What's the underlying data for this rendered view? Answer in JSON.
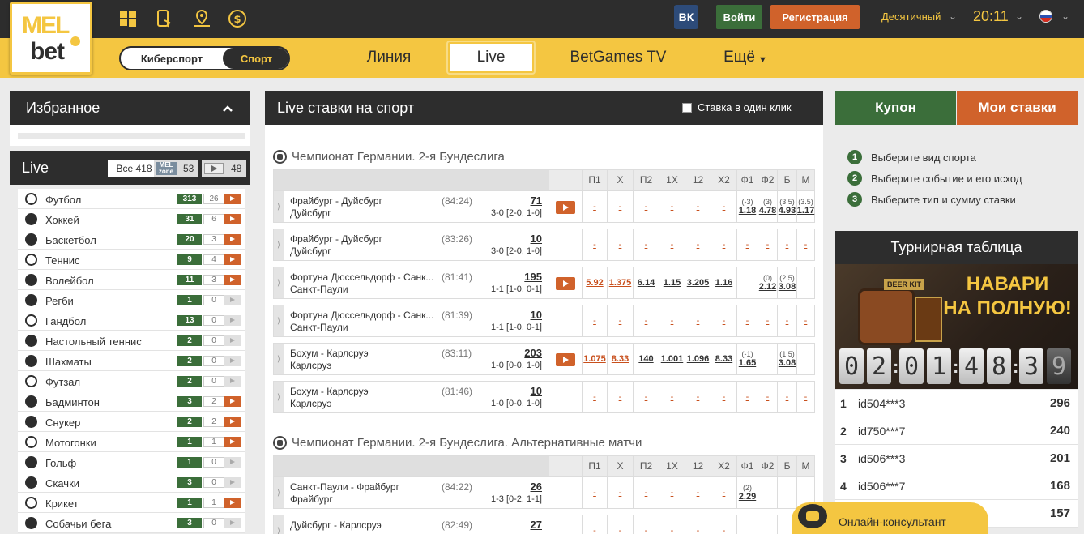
{
  "header": {
    "logo_top": "MEL",
    "logo_bottom": "bet",
    "vk_label": "ВК",
    "login_label": "Войти",
    "register_label": "Регистрация",
    "odds_format": "Десятичный",
    "time": "20:11",
    "toggle_esports": "Киберспорт",
    "toggle_sport": "Спорт",
    "nav": [
      "Линия",
      "Live",
      "BetGames TV",
      "Ещё"
    ],
    "colors": {
      "dark": "#2d2d2d",
      "yellow": "#f4c641",
      "green": "#3b6e3a",
      "orange": "#d0622b"
    }
  },
  "sidebar": {
    "favorites_title": "Избранное",
    "live_title": "Live",
    "count_all": "Все 418",
    "melzone_label": "MEL zone",
    "count_melzone": "53",
    "count_video": "48",
    "sports": [
      {
        "name": "Футбол",
        "c1": "313",
        "c2": "26",
        "video": true
      },
      {
        "name": "Хоккей",
        "c1": "31",
        "c2": "6",
        "video": true
      },
      {
        "name": "Баскетбол",
        "c1": "20",
        "c2": "3",
        "video": true
      },
      {
        "name": "Теннис",
        "c1": "9",
        "c2": "4",
        "video": true
      },
      {
        "name": "Волейбол",
        "c1": "11",
        "c2": "3",
        "video": true
      },
      {
        "name": "Регби",
        "c1": "1",
        "c2": "0",
        "video": false
      },
      {
        "name": "Гандбол",
        "c1": "13",
        "c2": "0",
        "video": false
      },
      {
        "name": "Настольный теннис",
        "c1": "2",
        "c2": "0",
        "video": false
      },
      {
        "name": "Шахматы",
        "c1": "2",
        "c2": "0",
        "video": false
      },
      {
        "name": "Футзал",
        "c1": "2",
        "c2": "0",
        "video": false
      },
      {
        "name": "Бадминтон",
        "c1": "3",
        "c2": "2",
        "video": true
      },
      {
        "name": "Снукер",
        "c1": "2",
        "c2": "2",
        "video": true
      },
      {
        "name": "Мотогонки",
        "c1": "1",
        "c2": "1",
        "video": true
      },
      {
        "name": "Гольф",
        "c1": "1",
        "c2": "0",
        "video": false
      },
      {
        "name": "Скачки",
        "c1": "3",
        "c2": "0",
        "video": false
      },
      {
        "name": "Крикет",
        "c1": "1",
        "c2": "1",
        "video": true
      },
      {
        "name": "Собачьи бега",
        "c1": "3",
        "c2": "0",
        "video": false
      }
    ]
  },
  "main": {
    "title": "Live ставки на спорт",
    "one_click": "Ставка в один клик",
    "columns": [
      "П1",
      "Х",
      "П2",
      "1Х",
      "12",
      "Х2",
      "Ф1",
      "Ф2",
      "Б",
      "М"
    ],
    "league1": "Чемпионат Германии. 2-я Бундеслига",
    "league2": "Чемпионат Германии. 2-я Бундеслига. Альтернативные матчи",
    "matches1": [
      {
        "t1": "Фрайбург - Дуйсбург",
        "t2": "Дуйсбург",
        "time": "(84:24)",
        "count": "71",
        "score": "3-0 [2-0, 1-0]",
        "video": true,
        "odds": [
          [
            "",
            "-"
          ],
          [
            "",
            "-"
          ],
          [
            "",
            "-"
          ],
          [
            "",
            "-"
          ],
          [
            "",
            "-"
          ],
          [
            "",
            "-"
          ],
          [
            "(-3)",
            "1.18"
          ],
          [
            "(3)",
            "4.78"
          ],
          [
            "(3.5)",
            "4.93"
          ],
          [
            "(3.5)",
            "1.17"
          ]
        ]
      },
      {
        "t1": "Фрайбург - Дуйсбург",
        "t2": "Дуйсбург",
        "time": "(83:26)",
        "count": "10",
        "score": "3-0 [2-0, 1-0]",
        "video": false,
        "odds": [
          [
            "",
            "-"
          ],
          [
            "",
            "-"
          ],
          [
            "",
            "-"
          ],
          [
            "",
            "-"
          ],
          [
            "",
            "-"
          ],
          [
            "",
            "-"
          ],
          [
            "",
            "-"
          ],
          [
            "",
            "-"
          ],
          [
            "",
            "-"
          ],
          [
            "",
            "-"
          ]
        ]
      },
      {
        "t1": "Фортуна Дюссельдорф - Санк...",
        "t2": "Санкт-Паули",
        "time": "(81:41)",
        "count": "195",
        "score": "1-1 [1-0, 0-1]",
        "video": true,
        "odds": [
          [
            "",
            "5.92"
          ],
          [
            "",
            "1.375"
          ],
          [
            "",
            "6.14"
          ],
          [
            "",
            "1.15"
          ],
          [
            "",
            "3.205"
          ],
          [
            "",
            "1.16"
          ],
          [
            "",
            ""
          ],
          [
            "(0)",
            "2.12"
          ],
          [
            "(2.5)",
            "3.08"
          ],
          [
            "",
            ""
          ]
        ]
      },
      {
        "t1": "Фортуна Дюссельдорф - Санк...",
        "t2": "Санкт-Паули",
        "time": "(81:39)",
        "count": "10",
        "score": "1-1 [1-0, 0-1]",
        "video": false,
        "odds": [
          [
            "",
            "-"
          ],
          [
            "",
            "-"
          ],
          [
            "",
            "-"
          ],
          [
            "",
            "-"
          ],
          [
            "",
            "-"
          ],
          [
            "",
            "-"
          ],
          [
            "",
            "-"
          ],
          [
            "",
            "-"
          ],
          [
            "",
            "-"
          ],
          [
            "",
            "-"
          ]
        ]
      },
      {
        "t1": "Бохум - Карлсруэ",
        "t2": "Карлсруэ",
        "time": "(83:11)",
        "count": "203",
        "score": "1-0 [0-0, 1-0]",
        "video": true,
        "odds": [
          [
            "",
            "1.075"
          ],
          [
            "",
            "8.33"
          ],
          [
            "",
            "140"
          ],
          [
            "",
            "1.001"
          ],
          [
            "",
            "1.096"
          ],
          [
            "",
            "8.33"
          ],
          [
            "(-1)",
            "1.65"
          ],
          [
            "",
            ""
          ],
          [
            "(1.5)",
            "3.08"
          ],
          [
            "",
            ""
          ]
        ]
      },
      {
        "t1": "Бохум - Карлсруэ",
        "t2": "Карлсруэ",
        "time": "(81:46)",
        "count": "10",
        "score": "1-0 [0-0, 1-0]",
        "video": false,
        "odds": [
          [
            "",
            "-"
          ],
          [
            "",
            "-"
          ],
          [
            "",
            "-"
          ],
          [
            "",
            "-"
          ],
          [
            "",
            "-"
          ],
          [
            "",
            "-"
          ],
          [
            "",
            "-"
          ],
          [
            "",
            "-"
          ],
          [
            "",
            "-"
          ],
          [
            "",
            "-"
          ]
        ]
      }
    ],
    "matches2": [
      {
        "t1": "Санкт-Паули - Фрайбург",
        "t2": "Фрайбург",
        "time": "(84:22)",
        "count": "26",
        "score": "1-3 [0-2, 1-1]",
        "video": false,
        "odds": [
          [
            "",
            "-"
          ],
          [
            "",
            "-"
          ],
          [
            "",
            "-"
          ],
          [
            "",
            "-"
          ],
          [
            "",
            "-"
          ],
          [
            "",
            "-"
          ],
          [
            "(2)",
            "2.29"
          ],
          [
            "",
            ""
          ],
          [
            "",
            ""
          ],
          [
            "",
            ""
          ]
        ]
      },
      {
        "t1": "Дуйсбург - Карлсруэ",
        "t2": "",
        "time": "(82:49)",
        "count": "27",
        "score": "",
        "video": false,
        "odds": [
          [
            "",
            "-"
          ],
          [
            "",
            "-"
          ],
          [
            "",
            "-"
          ],
          [
            "",
            "-"
          ],
          [
            "",
            "-"
          ],
          [
            "",
            "-"
          ],
          [
            "",
            ""
          ],
          [
            "",
            ""
          ],
          [
            "",
            ""
          ],
          [
            "",
            ""
          ]
        ]
      }
    ]
  },
  "right": {
    "coupon_tab": "Купон",
    "mybets_tab": "Мои ставки",
    "steps": [
      "Выберите вид спорта",
      "Выберите событие и его исход",
      "Выберите тип и сумму ставки"
    ],
    "tournament_title": "Турнирная таблица",
    "promo_badge": "BEER KIT",
    "promo_line1": "НАВАРИ",
    "promo_line2": "НА ПОЛНУЮ!",
    "countdown": [
      "0",
      "2",
      "0",
      "1",
      "4",
      "8",
      "3",
      "9"
    ],
    "ranks": [
      {
        "r": "1",
        "id": "id504***3",
        "pts": "296"
      },
      {
        "r": "2",
        "id": "id750***7",
        "pts": "240"
      },
      {
        "r": "3",
        "id": "id506***3",
        "pts": "201"
      },
      {
        "r": "4",
        "id": "id506***7",
        "pts": "168"
      },
      {
        "r": "",
        "id": "",
        "pts": "157"
      }
    ],
    "consultant": "Онлайн-консультант"
  }
}
